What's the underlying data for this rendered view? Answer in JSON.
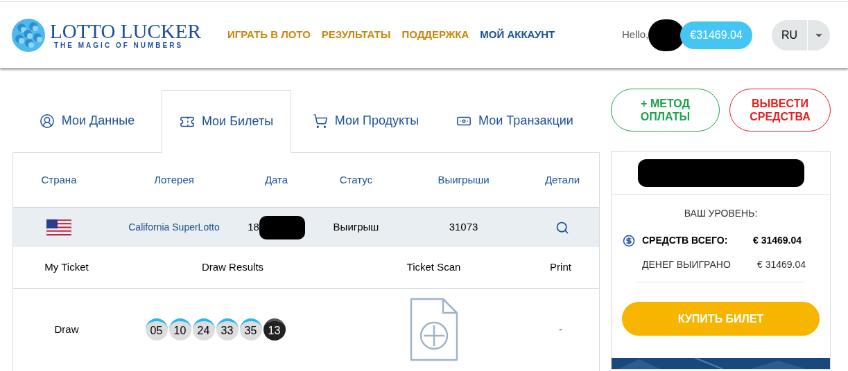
{
  "header": {
    "logo": {
      "title": "LOTTO LUCKER",
      "tagline": "THE MAGIC OF NUMBERS"
    },
    "nav": [
      {
        "label": "ИГРАТЬ В ЛОТО",
        "selected": false
      },
      {
        "label": "РЕЗУЛЬТАТЫ",
        "selected": false
      },
      {
        "label": "ПОДДЕРЖКА",
        "selected": false
      },
      {
        "label": "МОЙ АККАУНТ",
        "selected": true
      }
    ],
    "greeting": "Hello,",
    "balance": "€31469.04",
    "language": "RU"
  },
  "tabs": [
    {
      "label": "Мои Данные",
      "kind": "profile",
      "selected": false
    },
    {
      "label": "Мои Билеты",
      "kind": "tickets",
      "selected": true
    },
    {
      "label": "Мои Продукты",
      "kind": "products",
      "selected": false
    },
    {
      "label": "Мои Транзакции",
      "kind": "transactions",
      "selected": false
    }
  ],
  "table": {
    "columns": [
      "Страна",
      "Лотерея",
      "Дата",
      "Статус",
      "Выигрыши",
      "Детали"
    ],
    "rows": [
      {
        "lottery": "California SuperLotto",
        "date": "18",
        "status": "Выигрыш",
        "winnings": "31073"
      }
    ]
  },
  "ticket": {
    "columns": [
      "My Ticket",
      "Draw Results",
      "Ticket Scan",
      "Print"
    ],
    "rows": [
      {
        "label": "Draw",
        "balls": [
          {
            "number": "05",
            "kind": "main"
          },
          {
            "number": "10",
            "kind": "main"
          },
          {
            "number": "24",
            "kind": "main"
          },
          {
            "number": "33",
            "kind": "main"
          },
          {
            "number": "35",
            "kind": "main"
          },
          {
            "number": "13",
            "kind": "bonus"
          }
        ],
        "print": "-"
      }
    ]
  },
  "actions": {
    "add_method": {
      "plus": "+",
      "label": "МЕТОД ОПЛАТЫ"
    },
    "withdraw": "ВЫВЕСТИ СРЕДСТВА"
  },
  "account": {
    "level_label": "ВАШ УРОВЕНЬ:",
    "total_label": "СРЕДСТВ ВСЕГО:",
    "total_value": "€ 31469.04",
    "won_label": "ДЕНЕГ ВЫИГРАНО",
    "won_value": "€ 31469.04",
    "buy_button": "КУПИТЬ БИЛЕТ"
  }
}
